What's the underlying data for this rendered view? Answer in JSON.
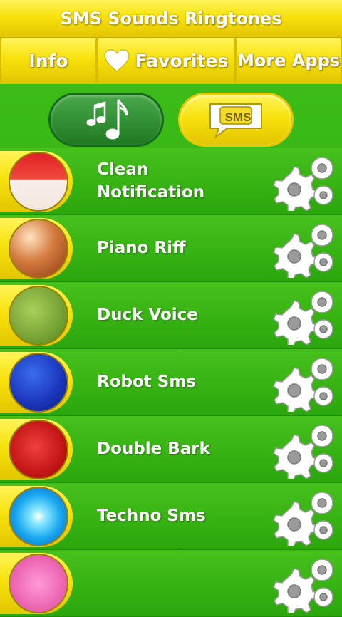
{
  "header": {
    "title": "SMS Sounds Ringtones"
  },
  "tabs": {
    "info": "Info",
    "favorites": "Favorites",
    "more_apps": "More Apps"
  },
  "toggles": {
    "sms_label": "SMS"
  },
  "ringtones": [
    {
      "name": "Clean\nNotification",
      "art": "red-white-sphere"
    },
    {
      "name": "Piano Riff",
      "art": "orange-swirl"
    },
    {
      "name": "Duck Voice",
      "art": "green-sparkle"
    },
    {
      "name": "Robot Sms",
      "art": "blue-dots"
    },
    {
      "name": "Double Bark",
      "art": "red-cross-stripes"
    },
    {
      "name": "Techno Sms",
      "art": "cyan-burst"
    },
    {
      "name": "",
      "art": "pink"
    }
  ],
  "colors": {
    "accent_yellow": "#f7e20c",
    "background_green": "#3cbc16",
    "music_toggle_green": "#2e8f33"
  }
}
